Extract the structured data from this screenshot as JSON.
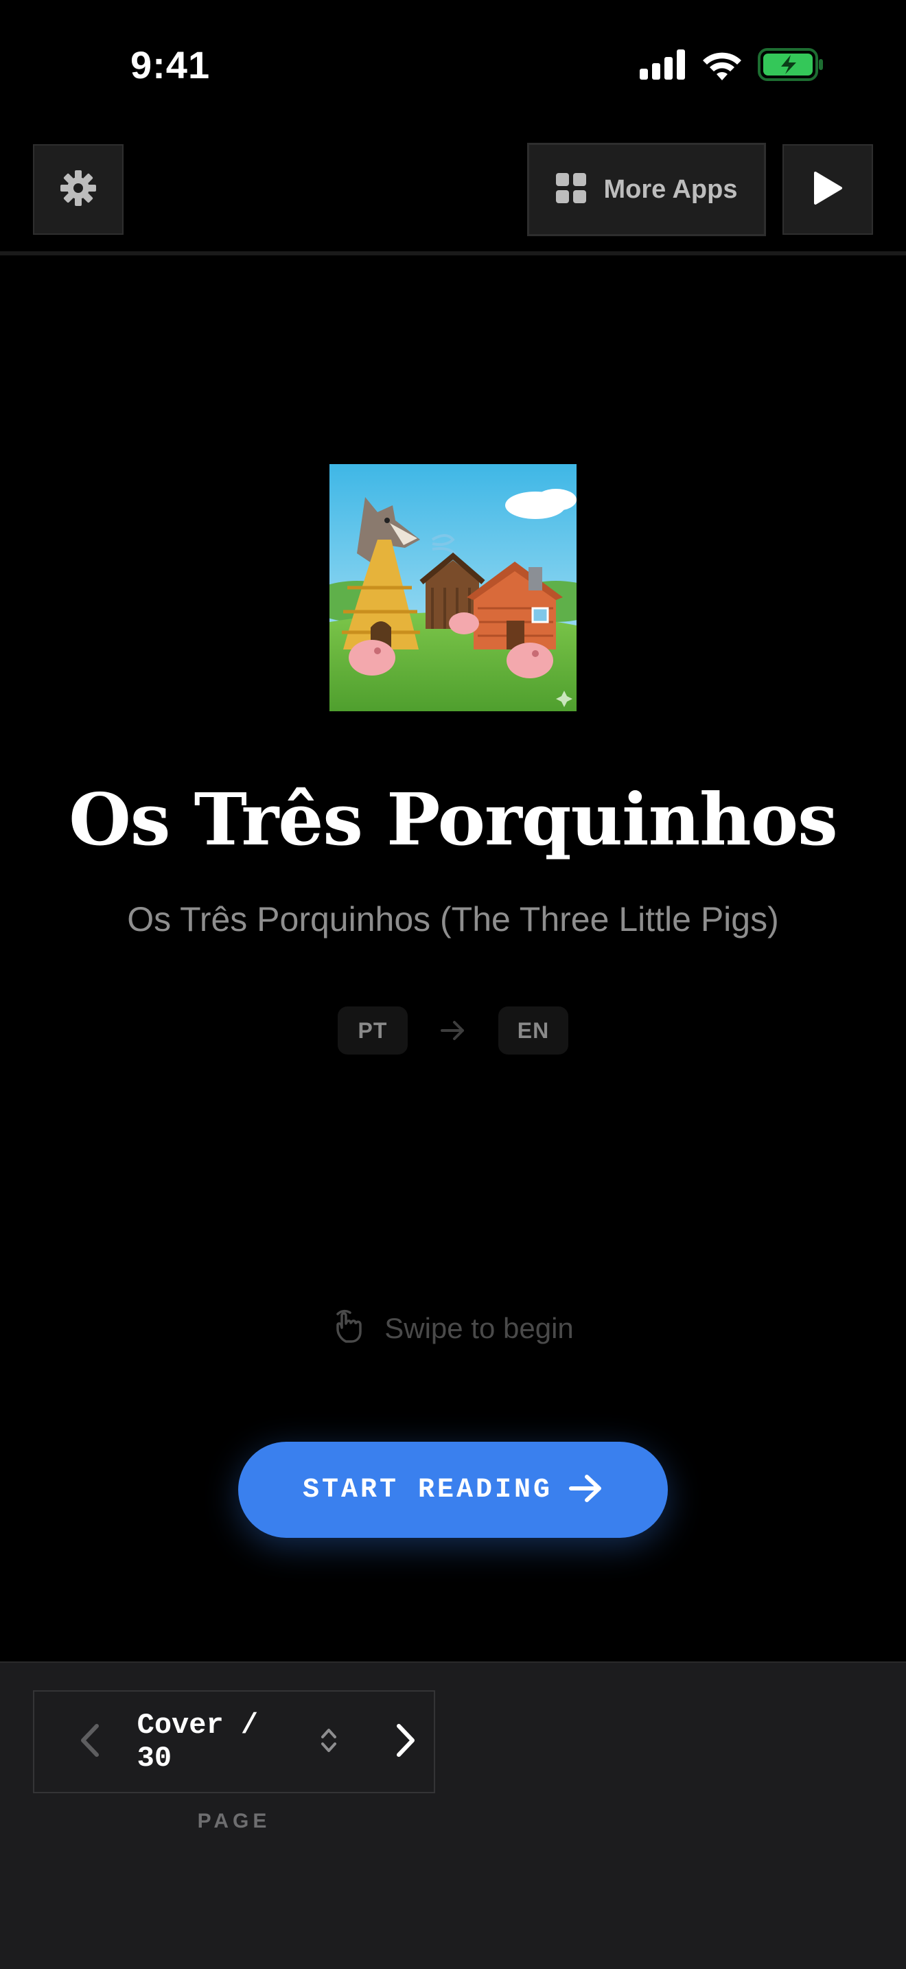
{
  "status_bar": {
    "time": "9:41",
    "icons": [
      "cellular-signal-icon",
      "wifi-icon",
      "battery-charging-icon"
    ],
    "battery_color": "#34c759"
  },
  "toolbar": {
    "settings_icon": "gear-icon",
    "more_apps_label": "More Apps",
    "more_apps_icon": "grid-icon",
    "play_icon": "play-icon"
  },
  "book": {
    "cover_image": "three-little-pigs-cover-illustration",
    "title": "Os Três Porquinhos",
    "subtitle": "Os Três Porquinhos (The Three Little Pigs)",
    "source_lang": "PT",
    "target_lang": "EN"
  },
  "swipe_hint": {
    "icon": "hand-tap-icon",
    "label": "Swipe to begin"
  },
  "start_button": {
    "label": "START READING",
    "icon": "arrow-right-icon",
    "color": "#3a80ee"
  },
  "pager": {
    "current": "Cover / 30",
    "caption": "PAGE"
  },
  "colors": {
    "background": "#000000",
    "bottom_bar": "#1c1c1e",
    "accent": "#3a80ee"
  }
}
